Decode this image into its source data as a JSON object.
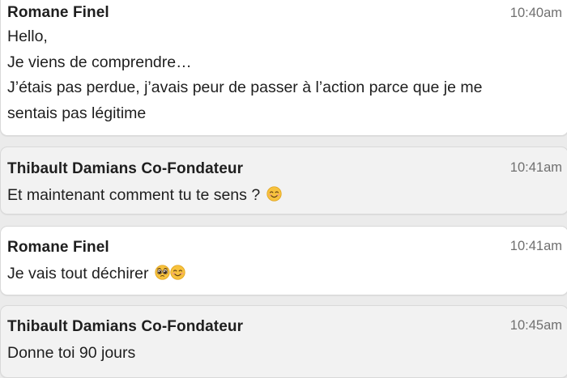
{
  "messages": [
    {
      "sender": "Romane Finel",
      "time": "10:40am",
      "lines": [
        "Hello,",
        "Je viens de comprendre…",
        "J’étais pas perdue, j’avais peur de passer à l’action parce que je me",
        "sentais pas légitime"
      ]
    },
    {
      "sender": "Thibault Damians Co-Fondateur",
      "time": "10:41am",
      "text": "Et maintenant comment tu te sens ?",
      "emojis": [
        "smiling-face-icon"
      ]
    },
    {
      "sender": "Romane Finel",
      "time": "10:41am",
      "text": "Je vais tout déchirer",
      "emojis": [
        "pleading-face-icon",
        "smiling-face-icon"
      ]
    },
    {
      "sender": "Thibault Damians Co-Fondateur",
      "time": "10:45am",
      "text": "Donne toi 90 jours"
    }
  ],
  "colors": {
    "background": "#ebebeb",
    "card_light": "#ffffff",
    "card_grey": "#f2f2f2",
    "sender_text": "#1e1e1e",
    "timestamp_text": "#707070",
    "emoji_yellow": "#f7c23d"
  }
}
